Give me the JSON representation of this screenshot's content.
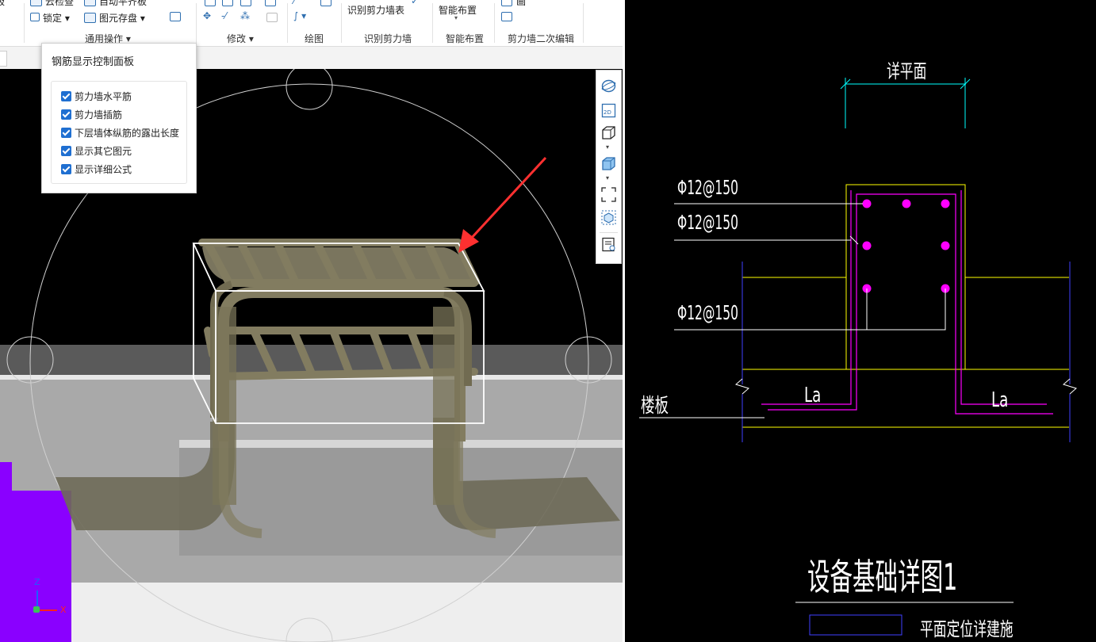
{
  "ribbon": {
    "row1": {
      "cloud_check": "云检查",
      "auto_floor": "自动平齐板",
      "identify_wall_table": "识别剪力墙表",
      "smart_layout": "智能布置"
    },
    "row2": {
      "lock": "锁定",
      "store_elements": "图元存盘"
    },
    "groups": {
      "general": "通用操作",
      "modify": "修改",
      "draw": "绘图",
      "identify_wall": "识别剪力墙",
      "smart": "智能布置",
      "secondary_edit": "剪力墙二次编辑"
    }
  },
  "panel": {
    "title": "钢筋显示控制面板",
    "options": [
      {
        "label": "剪力墙水平筋",
        "checked": true
      },
      {
        "label": "剪力墙插筋",
        "checked": true
      },
      {
        "label": "下层墙体纵筋的露出长度",
        "checked": true
      },
      {
        "label": "显示其它图元",
        "checked": true
      },
      {
        "label": "显示详细公式",
        "checked": true
      }
    ]
  },
  "viewport": {
    "axis_z": "Z",
    "axis_x": "X",
    "toolbar_icons": [
      "orbit-icon",
      "2d-view-icon",
      "cube-view-icon",
      "dropdown-icon",
      "solid-cube-icon",
      "dropdown-icon",
      "fit-view-icon",
      "selection-box-icon",
      "display-settings-icon"
    ],
    "arrow_color": "#ff3030",
    "purple_color": "#8a00ff"
  },
  "cad": {
    "detail_plan": "详平面",
    "rebar_1": "Φ12@150",
    "rebar_2": "Φ12@150",
    "rebar_3": "Φ12@150",
    "slab": "楼板",
    "la_left": "La",
    "la_right": "La",
    "title": "设备基础详图1",
    "legend_note": "平面定位详建施",
    "colors": {
      "yellow": "#ffff00",
      "magenta": "#ff00ff",
      "cyan": "#00ffff",
      "blue": "#4040ff"
    }
  }
}
